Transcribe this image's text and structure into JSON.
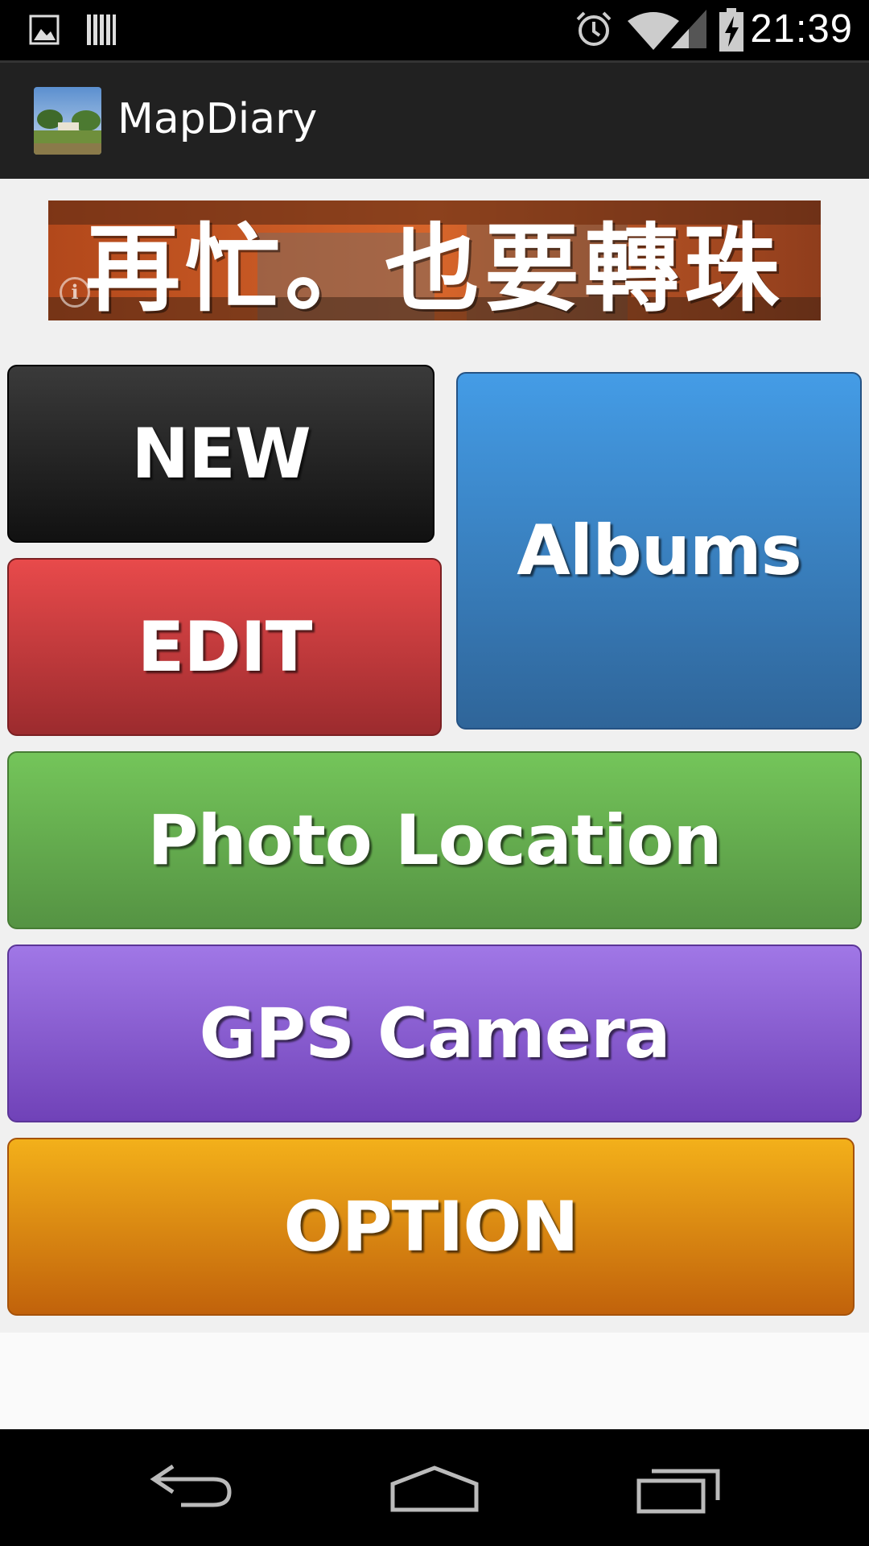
{
  "status_bar": {
    "time": "21:39",
    "left_icons": [
      "image-notification-icon",
      "barcode-notification-icon"
    ],
    "right_icons": [
      "alarm-icon",
      "wifi-icon",
      "cell-signal-icon",
      "battery-charging-icon"
    ]
  },
  "action_bar": {
    "title": "MapDiary",
    "icon": "app-landscape-icon"
  },
  "ad": {
    "text": "再忙。也要轉珠",
    "info_icon": "info-icon"
  },
  "buttons": {
    "new": "NEW",
    "edit": "EDIT",
    "albums": "Albums",
    "photo_location": "Photo Location",
    "gps_camera": "GPS Camera",
    "option": "OPTION"
  },
  "nav_bar": {
    "icons": [
      "back-icon",
      "home-icon",
      "recents-icon"
    ]
  },
  "colors": {
    "new": "#222222",
    "edit": "#d13b3d",
    "albums": "#3b82c4",
    "photo_location": "#64ab4e",
    "gps_camera": "#8555cf",
    "option": "#e08e12"
  }
}
